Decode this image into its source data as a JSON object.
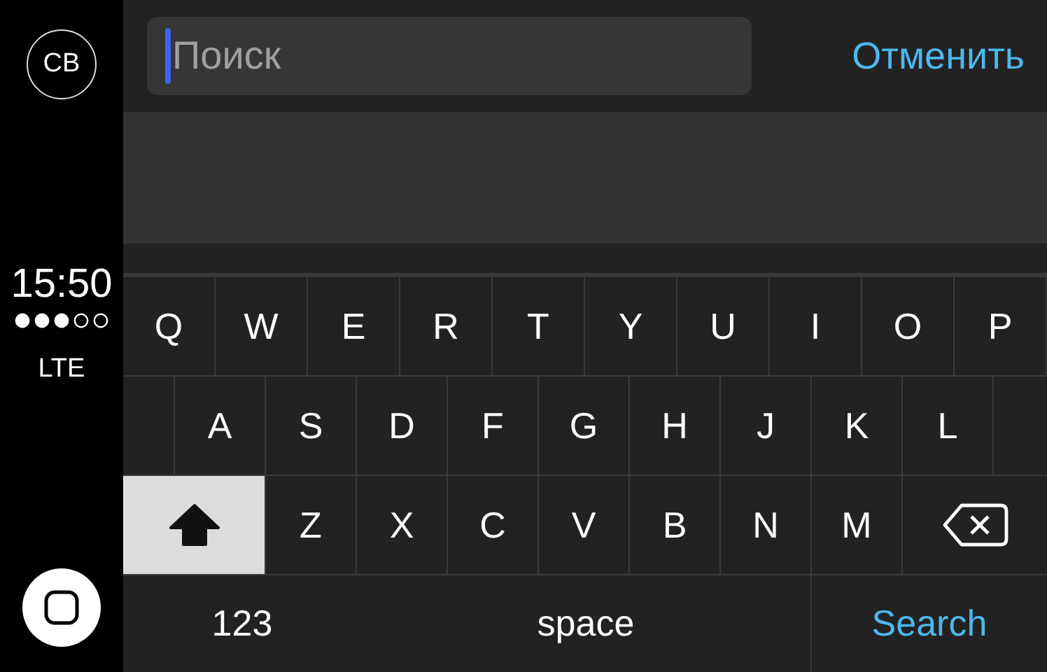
{
  "sidebar": {
    "avatar": "CB",
    "time": "15:50",
    "network": "LTE"
  },
  "search": {
    "placeholder": "Поиск",
    "focused": true,
    "cancel": "Отменить"
  },
  "keyboard": {
    "top_letters": [
      "Q",
      "W",
      "E",
      "R",
      "T",
      "Y",
      "U",
      "I",
      "O",
      "P"
    ],
    "middle_letters": [
      "A",
      "S",
      "D",
      "F",
      "G",
      "H",
      "J",
      "K",
      "L"
    ],
    "shift": {
      "on": true
    },
    "bottom_letters": [
      "Z",
      "X",
      "C",
      "V",
      "B",
      "N",
      "M"
    ],
    "numbers_key": "123",
    "space_key": "space",
    "action_key": "Search"
  }
}
